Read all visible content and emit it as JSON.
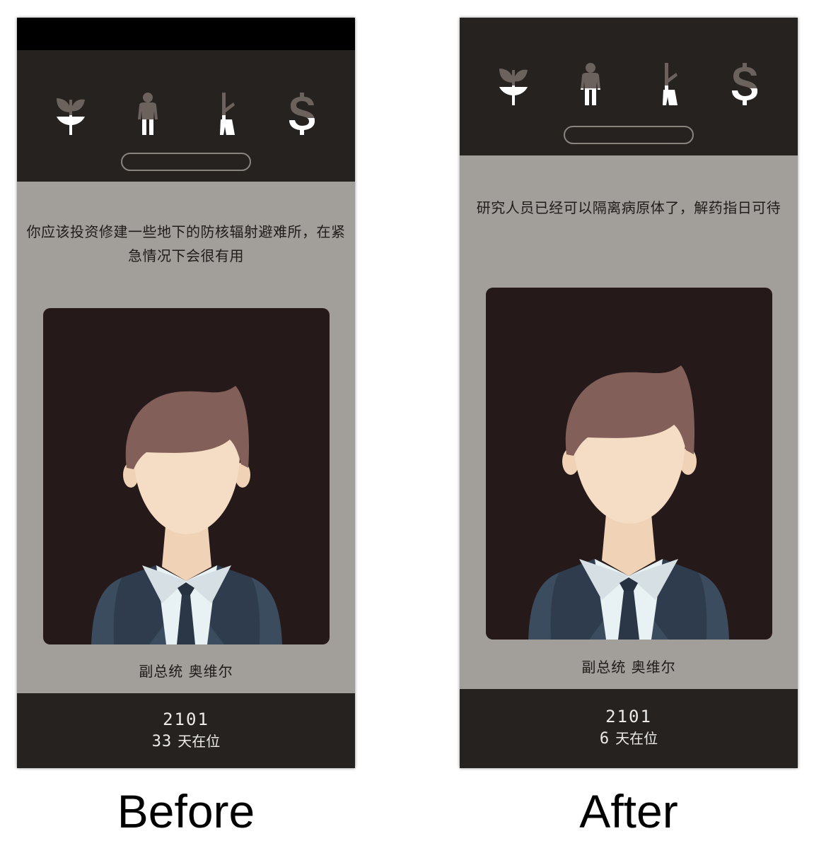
{
  "colors": {
    "panel_dark": "#252220",
    "panel_grey": "#a29e9a",
    "icon_empty": "#6b625d",
    "icon_fill": "#ffffff",
    "portrait_bg": "#26191a"
  },
  "stat_icons": [
    {
      "name": "plant-icon",
      "meaning": "religion"
    },
    {
      "name": "person-icon",
      "meaning": "people"
    },
    {
      "name": "rifle-icon",
      "meaning": "military"
    },
    {
      "name": "dollar-icon",
      "meaning": "money"
    }
  ],
  "panels": [
    {
      "caption": "Before",
      "advice": "你应该投资修建一些地下的防核辐射避难所，在紧急情况下会很有用",
      "speaker": "副总统  奥维尔",
      "year": "2101",
      "days_count": "33",
      "days_label": "天在位",
      "stat_levels": [
        0.5,
        0.0,
        0.55,
        0.0
      ]
    },
    {
      "caption": "After",
      "advice": "研究人员已经可以隔离病原体了，解药指日可待",
      "speaker": "副总统  奥维尔",
      "year": "2101",
      "days_count": "6",
      "days_label": "天在位",
      "stat_levels": [
        0.5,
        0.45,
        0.55,
        0.45
      ]
    }
  ]
}
